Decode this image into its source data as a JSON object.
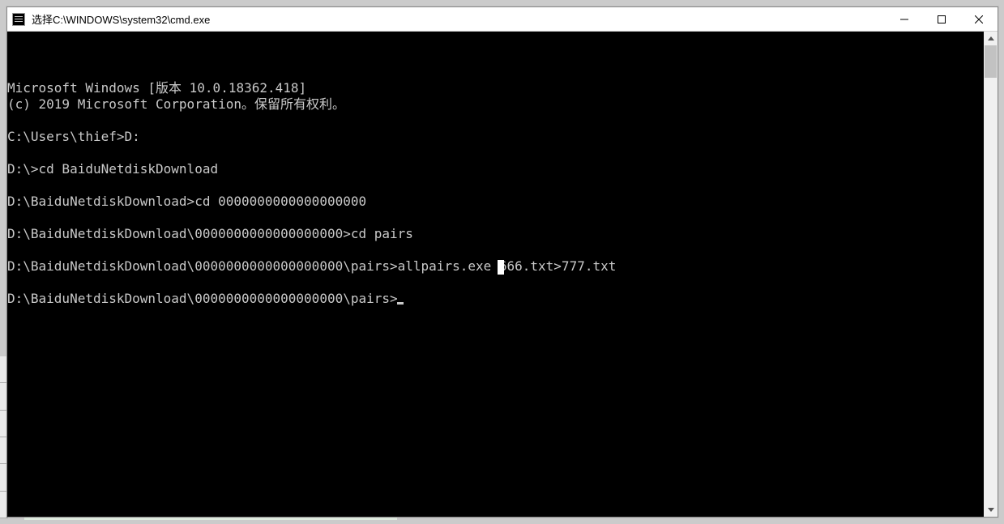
{
  "titlebar": {
    "title_text": "选择C:\\WINDOWS\\system32\\cmd.exe"
  },
  "terminal": {
    "lines": [
      "Microsoft Windows [版本 10.0.18362.418]",
      "(c) 2019 Microsoft Corporation。保留所有权利。",
      "",
      "C:\\Users\\thief>D:",
      "",
      "D:\\>cd BaiduNetdiskDownload",
      "",
      "D:\\BaiduNetdiskDownload>cd 0000000000000000000",
      "",
      "D:\\BaiduNetdiskDownload\\0000000000000000000>cd pairs",
      "",
      "D:\\BaiduNetdiskDownload\\0000000000000000000\\pairs>allpairs.exe 666.txt>777.txt",
      "",
      "D:\\BaiduNetdiskDownload\\0000000000000000000\\pairs>"
    ]
  }
}
